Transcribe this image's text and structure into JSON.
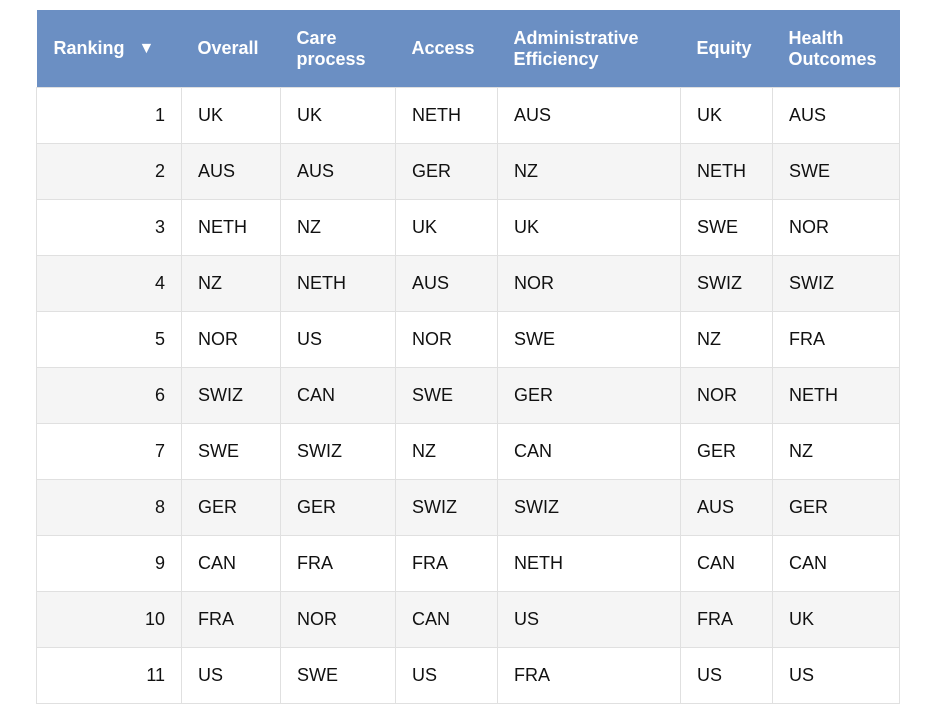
{
  "table": {
    "headers": {
      "ranking": "Ranking",
      "sort_indicator": "▼",
      "overall": "Overall",
      "care_process_1": "Care",
      "care_process_2": "process",
      "access": "Access",
      "admin_1": "Administrative",
      "admin_2": "Efficiency",
      "equity": "Equity",
      "health_1": "Health",
      "health_2": "Outcomes"
    },
    "rows": [
      {
        "rank": "1",
        "overall": "UK",
        "care": "UK",
        "access": "NETH",
        "admin": "AUS",
        "equity": "UK",
        "health": "AUS"
      },
      {
        "rank": "2",
        "overall": "AUS",
        "care": "AUS",
        "access": "GER",
        "admin": "NZ",
        "equity": "NETH",
        "health": "SWE"
      },
      {
        "rank": "3",
        "overall": "NETH",
        "care": "NZ",
        "access": "UK",
        "admin": "UK",
        "equity": "SWE",
        "health": "NOR"
      },
      {
        "rank": "4",
        "overall": "NZ",
        "care": "NETH",
        "access": "AUS",
        "admin": "NOR",
        "equity": "SWIZ",
        "health": "SWIZ"
      },
      {
        "rank": "5",
        "overall": "NOR",
        "care": "US",
        "access": "NOR",
        "admin": "SWE",
        "equity": "NZ",
        "health": "FRA"
      },
      {
        "rank": "6",
        "overall": "SWIZ",
        "care": "CAN",
        "access": "SWE",
        "admin": "GER",
        "equity": "NOR",
        "health": "NETH"
      },
      {
        "rank": "7",
        "overall": "SWE",
        "care": "SWIZ",
        "access": "NZ",
        "admin": "CAN",
        "equity": "GER",
        "health": "NZ"
      },
      {
        "rank": "8",
        "overall": "GER",
        "care": "GER",
        "access": "SWIZ",
        "admin": "SWIZ",
        "equity": "AUS",
        "health": "GER"
      },
      {
        "rank": "9",
        "overall": "CAN",
        "care": "FRA",
        "access": "FRA",
        "admin": "NETH",
        "equity": "CAN",
        "health": "CAN"
      },
      {
        "rank": "10",
        "overall": "FRA",
        "care": "NOR",
        "access": "CAN",
        "admin": "US",
        "equity": "FRA",
        "health": "UK"
      },
      {
        "rank": "11",
        "overall": "US",
        "care": "SWE",
        "access": "US",
        "admin": "FRA",
        "equity": "US",
        "health": "US"
      }
    ]
  },
  "colors": {
    "header_background": "#6b8fc3",
    "header_text": "#ffffff",
    "row_alt_background": "#f5f5f5",
    "grid_line": "#e0e0e0"
  }
}
